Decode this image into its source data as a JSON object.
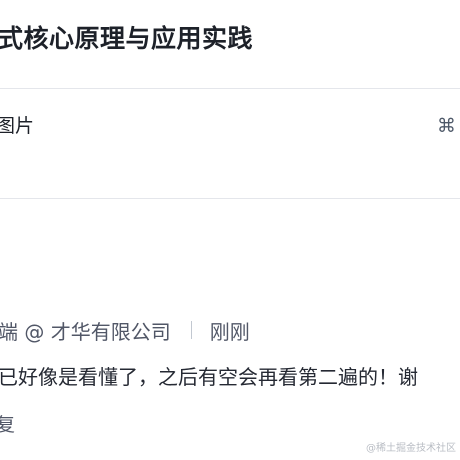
{
  "article": {
    "title": "式核心原理与应用实践"
  },
  "editor": {
    "hint_text": "图片",
    "shortcut_symbol": "⌘"
  },
  "comment": {
    "author": "端 @ 才华有限公司",
    "time": "刚刚",
    "text": "已好像是看懂了，之后有空会再看第二遍的！谢",
    "reply_label": "复"
  },
  "watermark": {
    "text": "@稀土掘金技术社区"
  },
  "colors": {
    "divider": "#e4e6eb",
    "meta_text": "#515767",
    "body_text": "#252933"
  }
}
